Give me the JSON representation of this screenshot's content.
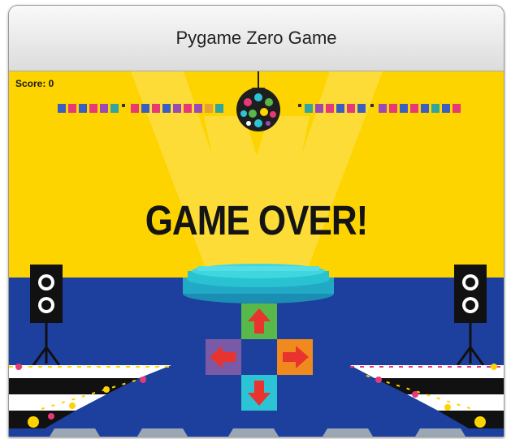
{
  "window": {
    "title": "Pygame Zero Game"
  },
  "hud": {
    "score_text": "Score: 0"
  },
  "overlay": {
    "message": "GAME OVER!"
  },
  "colors": {
    "back_wall": "#fdd300",
    "floor": "#1d3f9d",
    "stage_platform": "#29c2d0",
    "up_tile": "#58b84a",
    "left_tile": "#7a5aa6",
    "right_tile": "#f08a1e",
    "down_tile": "#2cc4d4",
    "arrow": "#e8332e"
  },
  "dance_pad": {
    "up_arrow_icon": "arrow-up-icon",
    "left_arrow_icon": "arrow-left-icon",
    "right_arrow_icon": "arrow-right-icon",
    "down_arrow_icon": "arrow-down-icon"
  }
}
